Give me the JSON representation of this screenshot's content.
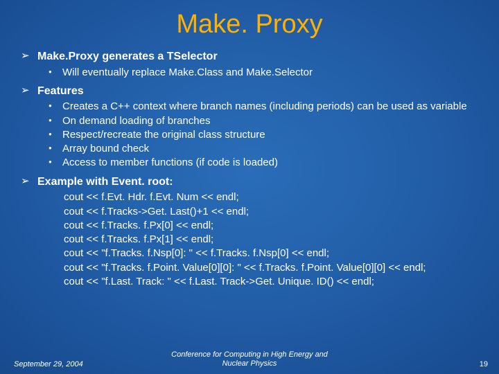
{
  "title": "Make. Proxy",
  "sections": [
    {
      "heading": "Make.Proxy generates a TSelector",
      "items": [
        "Will eventually replace Make.Class and Make.Selector"
      ]
    },
    {
      "heading": "Features",
      "items": [
        "Creates a C++ context where branch names (including periods) can be used as variable",
        "On demand loading of branches",
        "Respect/recreate the original class structure",
        "Array bound check",
        "Access to member functions (if code is loaded)"
      ]
    },
    {
      "heading": "Example with Event. root:",
      "code": [
        "cout << f.Evt. Hdr. f.Evt. Num << endl;",
        "cout << f.Tracks->Get. Last()+1 << endl;",
        "cout << f.Tracks. f.Px[0] << endl;",
        "cout << f.Tracks. f.Px[1] << endl;",
        "cout << \"f.Tracks. f.Nsp[0]: \" << f.Tracks. f.Nsp[0] << endl;",
        "cout << \"f.Tracks. f.Point. Value[0][0]: \" << f.Tracks. f.Point. Value[0][0] << endl;",
        "cout << \"f.Last. Track: \" << f.Last. Track->Get. Unique. ID() << endl;"
      ]
    }
  ],
  "footer": {
    "date": "September 29, 2004",
    "conference_line1": "Conference for Computing in High Energy and",
    "conference_line2": "Nuclear Physics",
    "page": "19"
  }
}
